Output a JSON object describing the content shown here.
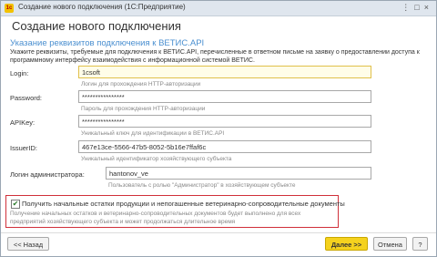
{
  "window": {
    "app_icon": "1c",
    "title": "Создание нового подключения  (1С:Предприятие)",
    "controls": [
      "⋮",
      "□",
      "×"
    ]
  },
  "heading": "Создание нового подключения",
  "section": "Указание реквизитов подключения к ВЕТИС.API",
  "description": "Укажите реквизиты, требуемые для подключения к ВЕТИС.API, перечисленные в ответном письме на заявку о предоставлении доступа к программному интерфейсу взаимодействия с информационной системой ВЕТИС.",
  "fields": {
    "login": {
      "label": "Login:",
      "value": "1csoft",
      "hint": "Логин для прохождения HTTP-авторизации"
    },
    "password": {
      "label": "Password:",
      "value": "****************",
      "hint": "Пароль для прохождения HTTP-авторизации"
    },
    "apikey": {
      "label": "APIKey:",
      "value": "****************",
      "hint": "Уникальный ключ для идентификации в ВЕТИС.API"
    },
    "issuer": {
      "label": "IssuerID:",
      "value": "467e13ce-5566-47b5-8052-5b16e7ffaf6c",
      "hint": "Уникальный идентификатор хозяйствующего субъекта"
    },
    "admin": {
      "label": "Логин администратора:",
      "value": "hantonov_ve",
      "hint": "Пользователь с ролью \"Администратор\" в хозяйствующем субъекте"
    }
  },
  "checkbox": {
    "checked": true,
    "label": "Получить начальные остатки продукции и непогашенные ветеринарно-сопроводительные документы",
    "hint": "Получение начальных остатков и ветеринарно-сопроводительных документов будет выполнено для всех предприятий хозяйствующего субъекта и может продолжаться длительное время"
  },
  "buttons": {
    "back": "<< Назад",
    "next": "Далее >>",
    "cancel": "Отмена"
  },
  "colors": {
    "accent": "#4a8fd0",
    "highlight": "#d0303a",
    "primary_button": "#f5d21e"
  }
}
